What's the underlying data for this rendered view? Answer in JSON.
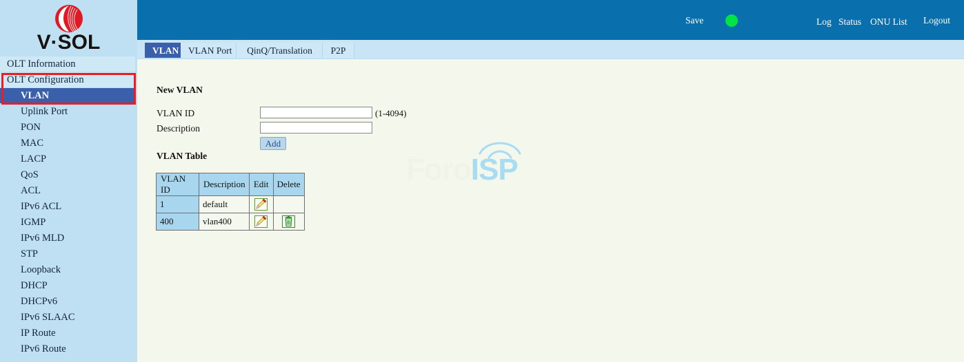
{
  "brand": {
    "name": "V·SOL",
    "logo_icon": "vsol-sphere-logo"
  },
  "sidebar": {
    "items": [
      {
        "label": "OLT Information",
        "type": "section",
        "active": false
      },
      {
        "label": "OLT Configuration",
        "type": "section",
        "active": false
      },
      {
        "label": "VLAN",
        "type": "sub",
        "active": true
      },
      {
        "label": "Uplink Port",
        "type": "sub",
        "active": false
      },
      {
        "label": "PON",
        "type": "sub",
        "active": false
      },
      {
        "label": "MAC",
        "type": "sub",
        "active": false
      },
      {
        "label": "LACP",
        "type": "sub",
        "active": false
      },
      {
        "label": "QoS",
        "type": "sub",
        "active": false
      },
      {
        "label": "ACL",
        "type": "sub",
        "active": false
      },
      {
        "label": "IPv6 ACL",
        "type": "sub",
        "active": false
      },
      {
        "label": "IGMP",
        "type": "sub",
        "active": false
      },
      {
        "label": "IPv6 MLD",
        "type": "sub",
        "active": false
      },
      {
        "label": "STP",
        "type": "sub",
        "active": false
      },
      {
        "label": "Loopback",
        "type": "sub",
        "active": false
      },
      {
        "label": "DHCP",
        "type": "sub",
        "active": false
      },
      {
        "label": "DHCPv6",
        "type": "sub",
        "active": false
      },
      {
        "label": "IPv6 SLAAC",
        "type": "sub",
        "active": false
      },
      {
        "label": "IP Route",
        "type": "sub",
        "active": false
      },
      {
        "label": "IPv6 Route",
        "type": "sub",
        "active": false
      }
    ],
    "highlight_color": "#ee1c22",
    "active_color": "#3a60ac"
  },
  "topbar": {
    "background": "#0a6fad",
    "save_label": "Save",
    "status_dot_color": "#00e544",
    "log_label": "Log",
    "status_label": "Status",
    "onu_list_label": "ONU List",
    "logout_label": "Logout"
  },
  "tabs": [
    {
      "label": "VLAN",
      "selected": true
    },
    {
      "label": "VLAN Port",
      "selected": false
    },
    {
      "label": "QinQ/Translation",
      "selected": false
    },
    {
      "label": "P2P",
      "selected": false
    }
  ],
  "new_vlan": {
    "heading": "New VLAN",
    "vlan_id_label": "VLAN ID",
    "vlan_id_value": "",
    "vlan_id_hint": "(1-4094)",
    "description_label": "Description",
    "description_value": "",
    "add_label": "Add"
  },
  "vlan_table": {
    "heading": "VLAN Table",
    "columns": [
      "VLAN ID",
      "Description",
      "Edit",
      "Delete"
    ],
    "rows": [
      {
        "vlan_id": "1",
        "description": "default",
        "edit_icon": "pencil-edit-icon",
        "delete_icon": ""
      },
      {
        "vlan_id": "400",
        "description": "vlan400",
        "edit_icon": "pencil-edit-icon",
        "delete_icon": "trash-delete-icon"
      }
    ]
  },
  "watermark": {
    "text_primary": "Foro",
    "text_accent": "ISP",
    "primary_color": "#f0f4e6",
    "accent_color": "#a8dcf2"
  }
}
